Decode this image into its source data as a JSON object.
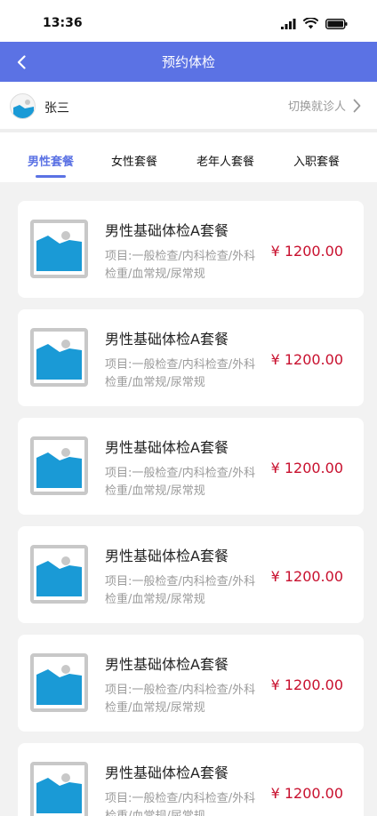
{
  "status_bar": {
    "time": "13:36"
  },
  "nav": {
    "title": "预约体检"
  },
  "patient": {
    "name": "张三",
    "switch_label": "切换就诊人"
  },
  "tabs": [
    {
      "label": "男性套餐",
      "active": true
    },
    {
      "label": "女性套餐",
      "active": false
    },
    {
      "label": "老年人套餐",
      "active": false
    },
    {
      "label": "入职套餐",
      "active": false
    }
  ],
  "packages": [
    {
      "title": "男性基础体检A套餐",
      "desc": "项目:一般检查/内科检查/外科检重/血常规/尿常规",
      "price": "¥ 1200.00"
    },
    {
      "title": "男性基础体检A套餐",
      "desc": "项目:一般检查/内科检查/外科检重/血常规/尿常规",
      "price": "¥ 1200.00"
    },
    {
      "title": "男性基础体检A套餐",
      "desc": "项目:一般检查/内科检查/外科检重/血常规/尿常规",
      "price": "¥ 1200.00"
    },
    {
      "title": "男性基础体检A套餐",
      "desc": "项目:一般检查/内科检查/外科检重/血常规/尿常规",
      "price": "¥ 1200.00"
    },
    {
      "title": "男性基础体检A套餐",
      "desc": "项目:一般检查/内科检查/外科检重/血常规/尿常规",
      "price": "¥ 1200.00"
    },
    {
      "title": "男性基础体检A套餐",
      "desc": "项目:一般检查/内科检查/外科检重/血常规/尿常规",
      "price": "¥ 1200.00"
    }
  ],
  "colors": {
    "primary": "#5b72e4",
    "price": "#c8102e",
    "thumb_blue": "#1a9ad6"
  },
  "icons": {
    "back": "chevron-left-icon",
    "switch": "chevron-right-icon",
    "thumb": "image-placeholder-icon",
    "signal": "signal-icon",
    "wifi": "wifi-icon",
    "battery": "battery-icon"
  }
}
